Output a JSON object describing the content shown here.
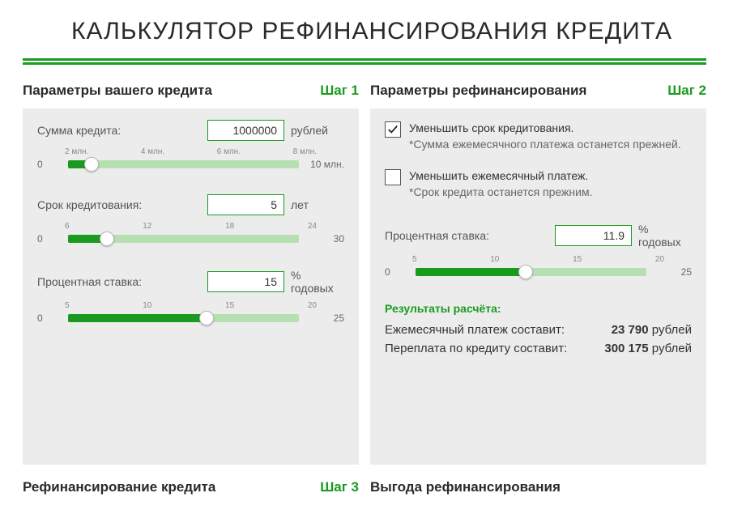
{
  "title": "КАЛЬКУЛЯТОР РЕФИНАНСИРОВАНИЯ КРЕДИТА",
  "step1": {
    "title": "Параметры вашего кредита",
    "badge": "Шаг 1",
    "amount": {
      "label": "Сумма кредита:",
      "value": "1000000",
      "unit": "рублей",
      "min": "0",
      "max": "10 млн.",
      "ticks": [
        "2 млн.",
        "4 млн.",
        "6 млн.",
        "8 млн."
      ],
      "fillPct": 10
    },
    "term": {
      "label": "Срок кредитования:",
      "value": "5",
      "unit": "лет",
      "min": "0",
      "max": "30",
      "ticks": [
        "6",
        "12",
        "18",
        "24"
      ],
      "fillPct": 17
    },
    "rate": {
      "label": "Процентная ставка:",
      "value": "15",
      "unit": "% годовых",
      "min": "0",
      "max": "25",
      "ticks": [
        "5",
        "10",
        "15",
        "20"
      ],
      "fillPct": 60
    }
  },
  "step2": {
    "title": "Параметры рефинансирования",
    "badge": "Шаг 2",
    "optReduceTerm": {
      "checked": true,
      "label": "Уменьшить срок кредитования.",
      "note": "*Сумма ежемесячного платежа останется прежней."
    },
    "optReducePayment": {
      "checked": false,
      "label": "Уменьшить ежемесячный платеж.",
      "note": "*Срок кредита останется прежним."
    },
    "rate": {
      "label": "Процентная ставка:",
      "value": "11.9",
      "unit": "% годовых",
      "min": "0",
      "max": "25",
      "ticks": [
        "5",
        "10",
        "15",
        "20"
      ],
      "fillPct": 47.6
    },
    "results": {
      "title": "Результаты расчёта:",
      "monthlyLabel": "Ежемесячный платеж составит:",
      "monthlyValue": "23 790",
      "monthlyUnit": "рублей",
      "overpayLabel": "Переплата по кредиту составит:",
      "overpayValue": "300 175",
      "overpayUnit": "рублей"
    }
  },
  "step3": {
    "title": "Рефинансирование кредита",
    "badge": "Шаг 3"
  },
  "step4": {
    "title": "Выгода рефинансирования"
  }
}
